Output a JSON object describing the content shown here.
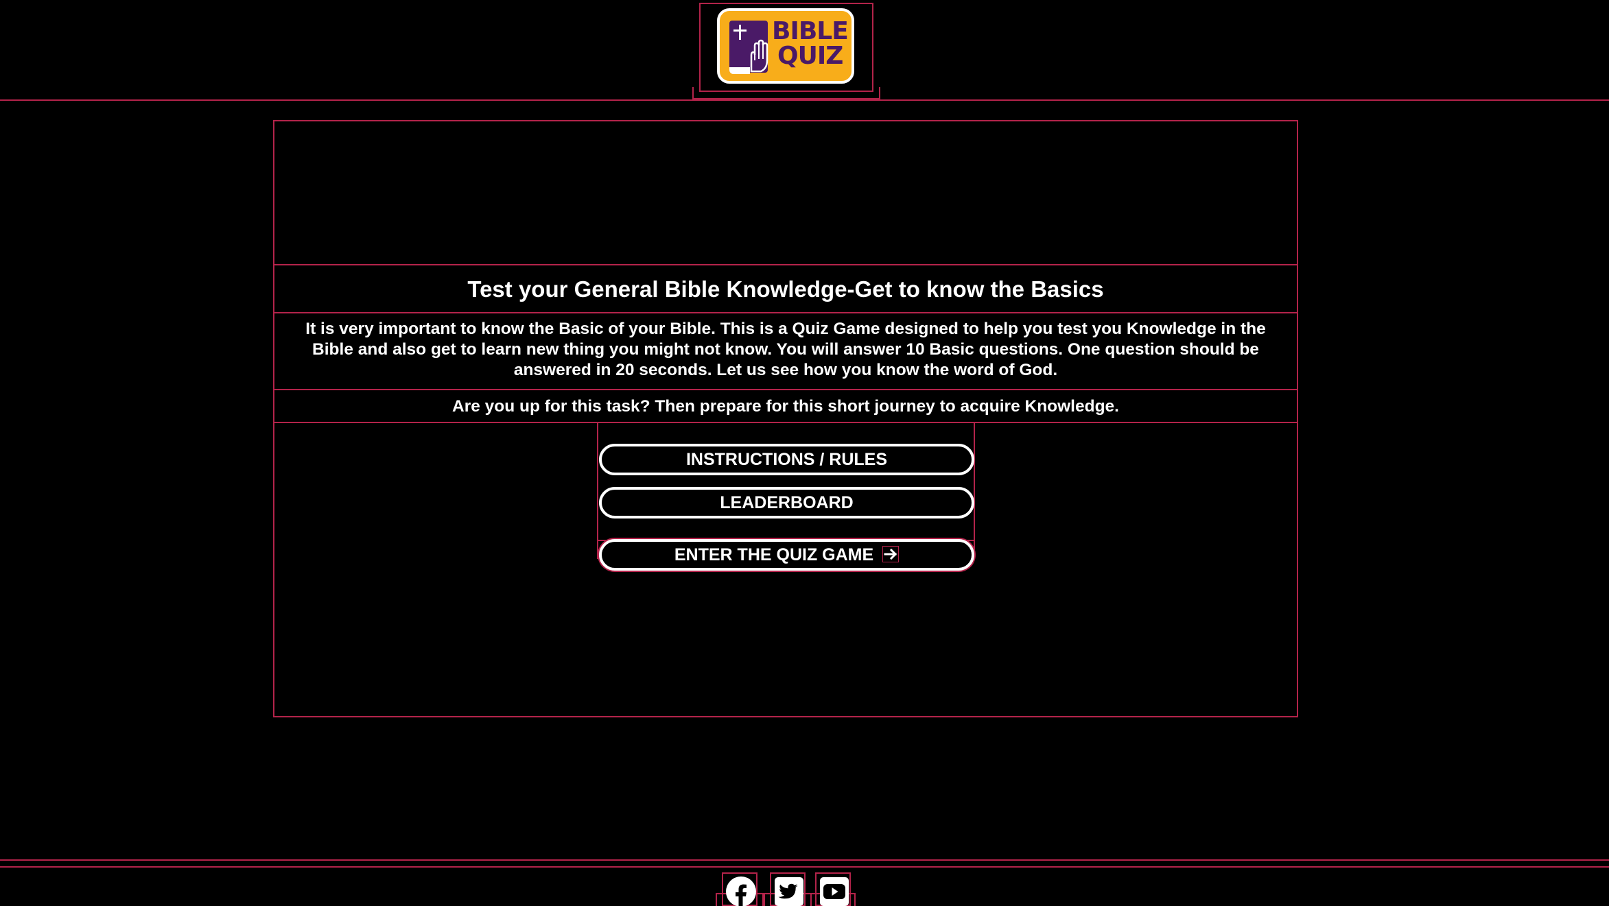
{
  "header": {
    "logo": {
      "text_line1": "BIBLE",
      "text_line2": "QUIZ",
      "icon": "bible-hand-icon",
      "colors": {
        "background": "#f8ad1a",
        "book": "#4a1a67",
        "text": "#4a1a67"
      }
    }
  },
  "main": {
    "title": "Test your General Bible Knowledge-Get to know the Basics",
    "description": "It is very important to know the Basic of your Bible. This is a Quiz Game designed to help you test you Knowledge in the Bible and also get to learn new thing you might not know. You will answer 10 Basic questions. One question should be answered in 20 seconds. Let us see how you know the word of God.",
    "prompt": "Are you up for this task? Then prepare for this short journey to acquire Knowledge.",
    "buttons": {
      "instructions": "INSTRUCTIONS / RULES",
      "leaderboard": "LEADERBOARD",
      "enter": "ENTER THE QUIZ GAME",
      "enter_icon": "arrow-right-icon"
    }
  },
  "footer": {
    "social": [
      {
        "name": "facebook",
        "icon": "facebook-icon"
      },
      {
        "name": "twitter",
        "icon": "twitter-icon"
      },
      {
        "name": "youtube",
        "icon": "youtube-icon"
      }
    ]
  },
  "colors": {
    "background": "#000000",
    "accent_border": "#b3234a",
    "text": "#ffffff"
  }
}
